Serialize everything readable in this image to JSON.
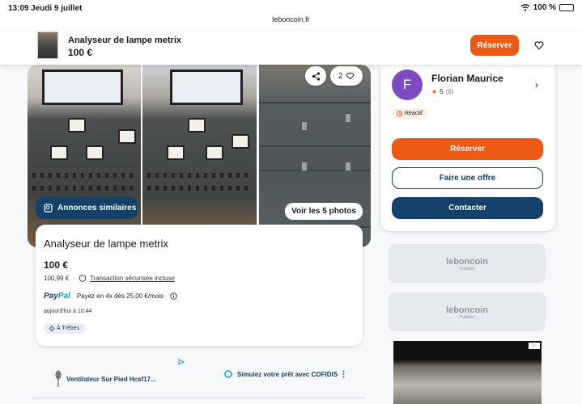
{
  "status_bar": {
    "time": "13:09",
    "date": "Jeudi 9 juillet",
    "url": "leboncoin.fr",
    "battery": "100 %"
  },
  "sticky_header": {
    "title": "Analyseur de lampe metrix",
    "price": "100 €",
    "reserve_label": "Réserver"
  },
  "gallery": {
    "share_icon": "share-icon",
    "favorites_count": "2",
    "similar_label": "Annonces similaires",
    "see_photos_label": "Voir les 5 photos"
  },
  "listing": {
    "title": "Analyseur de lampe metrix",
    "price": "100 €",
    "price_with_fees": "100,99 €",
    "secure_label": "Transaction sécurisée incluse",
    "paypal_prefix": "Pay",
    "paypal_suffix": "Pal",
    "paypal_text": "Payez en 4x dès 25,00 €/mois",
    "date": "aujourd'hui à 10:44",
    "location": "À Trèbes"
  },
  "seller": {
    "initial": "F",
    "name": "Florian Maurice",
    "rating": "5",
    "rating_count": "(6)",
    "badge": "Réactif",
    "reserve_label": "Réserver",
    "offer_label": "Faire une offre",
    "contact_label": "Contacter"
  },
  "ads": {
    "item1": "Ventilateur Sur Pied Hcsf17...",
    "item2": "Simulez votre prêt avec COFIDIS",
    "lbc_logo": "leboncoin",
    "lbc_pub": "Publicité"
  },
  "colors": {
    "accent_orange": "#ec5a13",
    "navy": "#14406a",
    "avatar": "#7d4cc2"
  }
}
